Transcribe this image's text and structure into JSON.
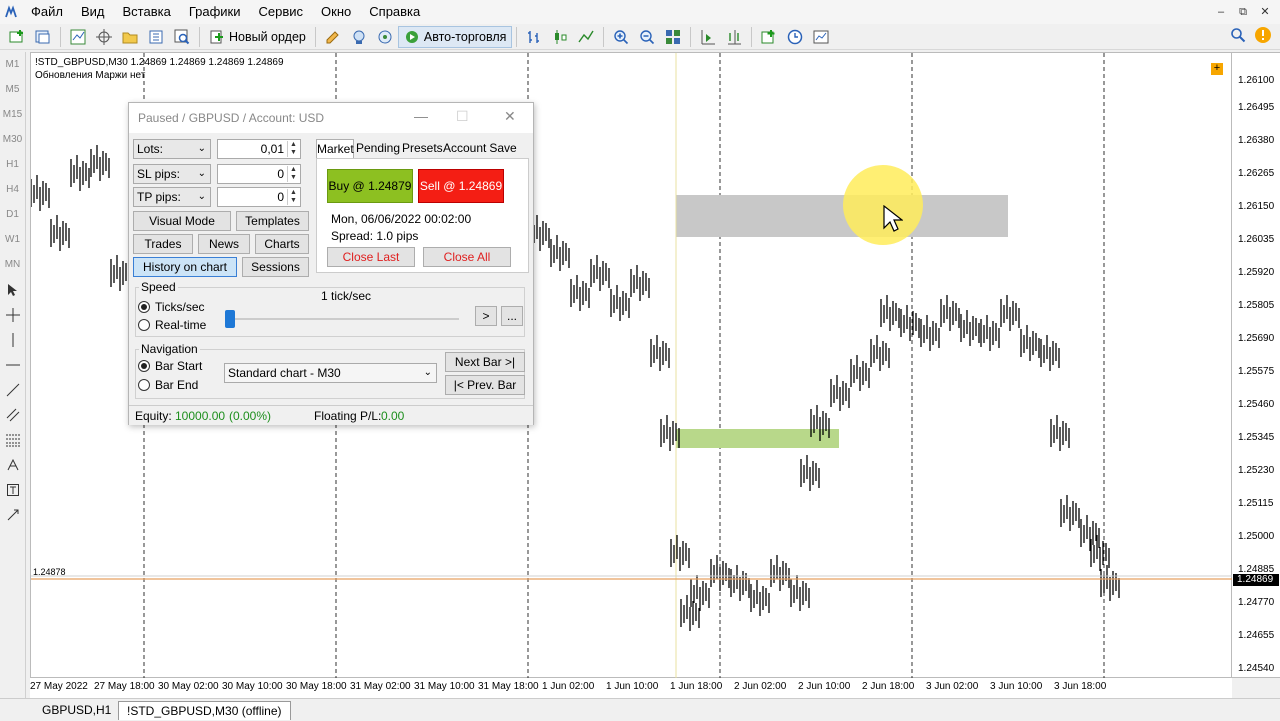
{
  "menu": [
    "Файл",
    "Вид",
    "Вставка",
    "Графики",
    "Сервис",
    "Окно",
    "Справка"
  ],
  "window_controls": [
    "–",
    "⧉",
    "✕"
  ],
  "toolbar": {
    "new_order": "Новый ордер",
    "auto_trading": "Авто-торговля"
  },
  "sidebar": {
    "timeframes": [
      "M1",
      "M5",
      "M15",
      "M30",
      "H1",
      "H4",
      "D1",
      "W1",
      "MN"
    ]
  },
  "chart": {
    "title": "!STD_GBPUSD,M30  1.24869 1.24869 1.24869 1.24869",
    "subtitle": "Обновления Маржи нет",
    "left_price": "1.24878",
    "current_price": "1.24869",
    "price_labels": [
      "1.26100",
      "1.26495",
      "1.26380",
      "1.26265",
      "1.26150",
      "1.26035",
      "1.25920",
      "1.25805",
      "1.25690",
      "1.25575",
      "1.25460",
      "1.25345",
      "1.25230",
      "1.25115",
      "1.25000",
      "1.24885",
      "1.24770",
      "1.24655",
      "1.24540"
    ],
    "time_labels": [
      "27 May 2022",
      "27 May 18:00",
      "30 May 02:00",
      "30 May 10:00",
      "30 May 18:00",
      "31 May 02:00",
      "31 May 10:00",
      "31 May 18:00",
      "1 Jun 02:00",
      "1 Jun 10:00",
      "1 Jun 18:00",
      "2 Jun 02:00",
      "2 Jun 10:00",
      "2 Jun 18:00",
      "3 Jun 02:00",
      "3 Jun 10:00",
      "3 Jun 18:00"
    ]
  },
  "tabs": [
    "GBPUSD,H1",
    "!STD_GBPUSD,M30 (offline)"
  ],
  "tester": {
    "title": "Paused / GBPUSD / Account: USD",
    "lots_label": "Lots:",
    "lots_value": "0,01",
    "sl_label": "SL pips:",
    "sl_value": "0",
    "tp_label": "TP pips:",
    "tp_value": "0",
    "buttons": {
      "visual_mode": "Visual Mode",
      "templates": "Templates",
      "trades": "Trades",
      "news": "News",
      "charts": "Charts",
      "history_on_chart": "History on chart",
      "sessions": "Sessions"
    },
    "tabs": [
      "Market",
      "Pending",
      "Presets",
      "Account",
      "Save"
    ],
    "market": {
      "buy": "Buy @ 1.24879",
      "sell": "Sell @ 1.24869",
      "datetime": "Mon, 06/06/2022  00:02:00",
      "spread": "Spread: 1.0 pips",
      "close_last": "Close Last",
      "close_all": "Close All"
    },
    "speed": {
      "label": "Speed",
      "rate": "1 tick/sec",
      "ticks_sec": "Ticks/sec",
      "real_time": "Real-time",
      "play": ">",
      "more": "..."
    },
    "navigation": {
      "label": "Navigation",
      "bar_start": "Bar Start",
      "bar_end": "Bar End",
      "chart_select": "Standard chart - M30",
      "next_bar": "Next Bar >|",
      "prev_bar": "|< Prev. Bar"
    },
    "status": {
      "equity_label": "Equity:",
      "equity_value": "10000.00",
      "equity_pct": "(0.00%)",
      "floating_label": "Floating P/L:",
      "floating_value": "0.00"
    }
  },
  "colors": {
    "buy": "#8dc021",
    "sell": "#f41e14",
    "price_line": "#e8a060",
    "gray_zone": "#c8c8c8",
    "green_zone": "#b8d88a"
  }
}
